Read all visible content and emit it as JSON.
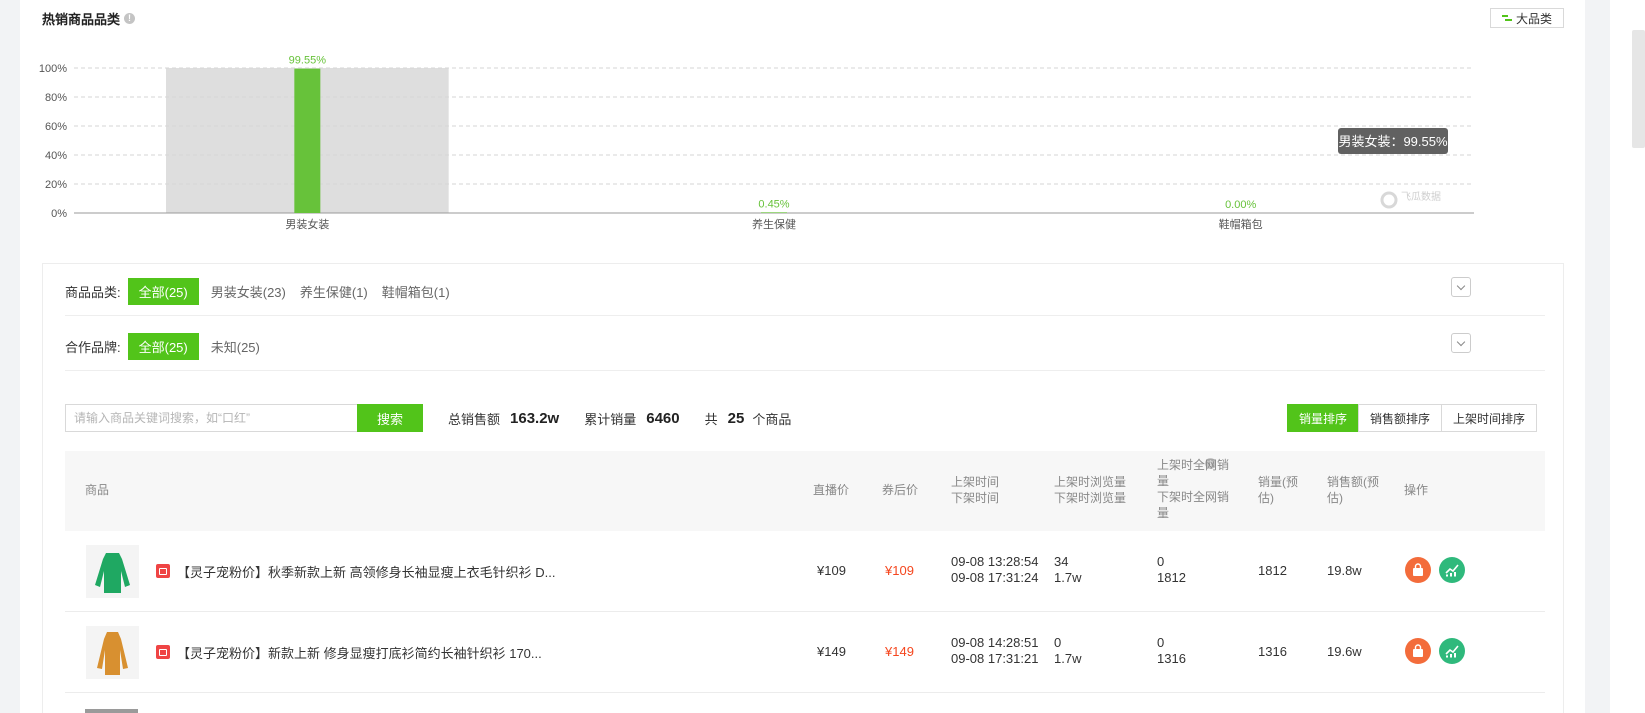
{
  "section": {
    "title": "热销商品品类",
    "toggle_label": "大品类"
  },
  "chart_data": {
    "type": "bar",
    "categories": [
      "男装女装",
      "养生保健",
      "鞋帽箱包"
    ],
    "values": [
      99.55,
      0.45,
      0.0
    ],
    "value_labels": [
      "99.55%",
      "0.45%",
      "0.00%"
    ],
    "y_ticks": [
      "0%",
      "20%",
      "40%",
      "60%",
      "80%",
      "100%"
    ],
    "ylim": [
      0,
      100
    ],
    "highlighted_category": "男装女装",
    "tooltip": "男装女装：99.55%",
    "bar_color": "#67c23a",
    "grid": true,
    "watermark": "飞瓜数据"
  },
  "filters": {
    "category": {
      "label": "商品品类:",
      "options": [
        "全部(25)",
        "男装女装(23)",
        "养生保健(1)",
        "鞋帽箱包(1)"
      ],
      "active": "全部(25)"
    },
    "brand": {
      "label": "合作品牌:",
      "options": [
        "全部(25)",
        "未知(25)"
      ],
      "active": "全部(25)"
    }
  },
  "search": {
    "placeholder": "请输入商品关键词搜索，如“口红”",
    "button": "搜索"
  },
  "stats": {
    "total_sales_label": "总销售额",
    "total_sales_value": "163.2w",
    "total_volume_label": "累计销量",
    "total_volume_value": "6460",
    "count_prefix": "共",
    "count_value": "25",
    "count_suffix": "个商品"
  },
  "sort": [
    "销量排序",
    "销售额排序",
    "上架时间排序"
  ],
  "table": {
    "headers": {
      "product": "商品",
      "live_price": "直播价",
      "coupon_price": "券后价",
      "time_1": "上架时间",
      "time_2": "下架时间",
      "views_1": "上架时浏览量",
      "views_2": "下架时浏览量",
      "net_sales_1": "上架时全网销",
      "net_sales_2": "量",
      "net_sales_3": "下架时全网销",
      "net_sales_4": "量",
      "volume_1": "销量(预",
      "volume_2": "估)",
      "revenue_1": "销售额(预",
      "revenue_2": "估)",
      "actions": "操作"
    },
    "rows": [
      {
        "title": "【灵子宠粉价】秋季新款上新 高领修身长袖显瘦上衣毛针织衫 D...",
        "live_price": "¥109",
        "coupon_price": "¥109",
        "on_time": "09-08 13:28:54",
        "off_time": "09-08 17:31:24",
        "on_views": "34",
        "off_views": "1.7w",
        "on_net_sales": "0",
        "off_net_sales": "1812",
        "volume": "1812",
        "revenue": "19.8w",
        "thumb_color": "#1fa862"
      },
      {
        "title": "【灵子宠粉价】新款上新 修身显瘦打底衫简约长袖针织衫 170...",
        "live_price": "¥149",
        "coupon_price": "¥149",
        "on_time": "09-08 14:28:51",
        "off_time": "09-08 17:31:21",
        "on_views": "0",
        "off_views": "1.7w",
        "on_net_sales": "0",
        "off_net_sales": "1316",
        "volume": "1316",
        "revenue": "19.6w",
        "thumb_color": "#d89030"
      }
    ]
  }
}
